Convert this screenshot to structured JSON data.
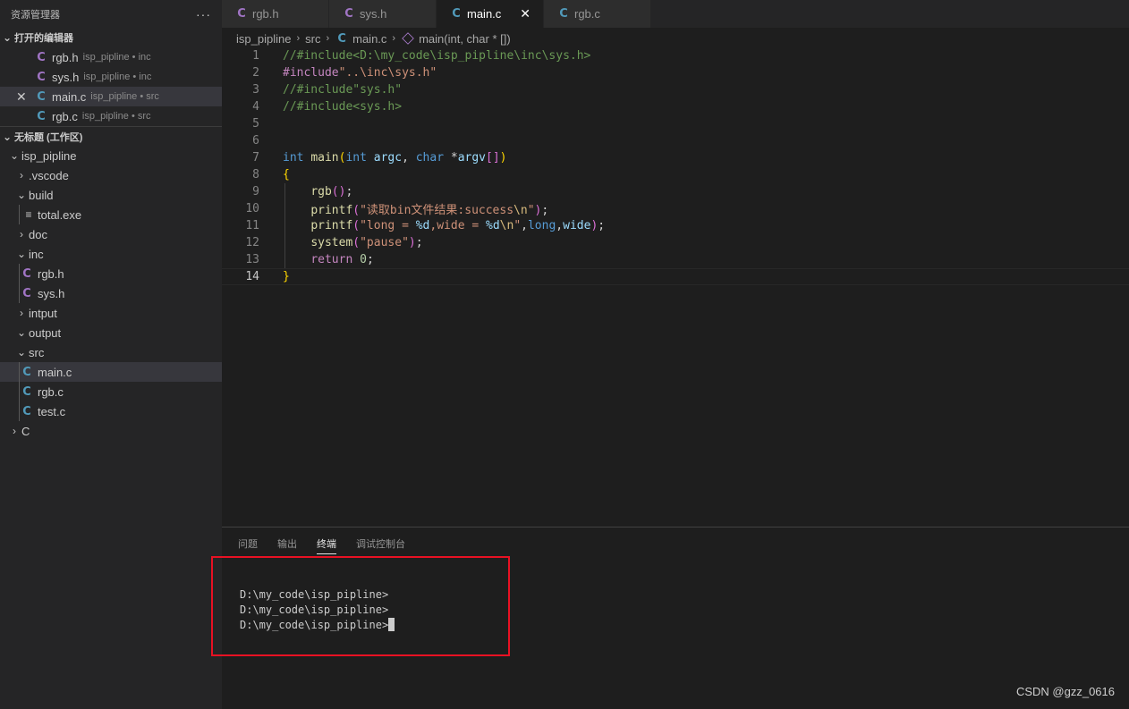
{
  "sidebar": {
    "title": "资源管理器",
    "more": "···",
    "open_editors_label": "打开的编辑器",
    "open_editors": [
      {
        "icon": "C",
        "name": "rgb.h",
        "desc": "isp_pipline • inc"
      },
      {
        "icon": "C",
        "name": "sys.h",
        "desc": "isp_pipline • inc"
      },
      {
        "icon": "C",
        "name": "main.c",
        "desc": "isp_pipline • src"
      },
      {
        "icon": "C",
        "name": "rgb.c",
        "desc": "isp_pipline • src"
      }
    ],
    "workspace_label": "无标题 (工作区)",
    "tree": {
      "root": "isp_pipline",
      "vscode": ".vscode",
      "build": "build",
      "total_exe": "total.exe",
      "doc": "doc",
      "inc": "inc",
      "inc_rgb_h": "rgb.h",
      "inc_sys_h": "sys.h",
      "intput": "intput",
      "output": "output",
      "src": "src",
      "src_main_c": "main.c",
      "src_rgb_c": "rgb.c",
      "src_test_c": "test.c",
      "c_folder": "C"
    }
  },
  "tabs": [
    {
      "icon": "C",
      "label": "rgb.h"
    },
    {
      "icon": "C",
      "label": "sys.h"
    },
    {
      "icon": "C",
      "label": "main.c"
    },
    {
      "icon": "C",
      "label": "rgb.c"
    }
  ],
  "tab_close": "✕",
  "breadcrumb": {
    "folder": "isp_pipline",
    "sub": "src",
    "file_icon": "C",
    "file": "main.c",
    "symbol": "main(int, char * [])"
  },
  "editor": {
    "line_numbers": [
      "1",
      "2",
      "3",
      "4",
      "5",
      "6",
      "7",
      "8",
      "9",
      "10",
      "11",
      "12",
      "13",
      "14"
    ],
    "l1": "//#include<D:\\my_code\\isp_pipline\\inc\\sys.h>",
    "l2_a": "#include",
    "l2_b": "\"..\\inc\\sys.h\"",
    "l3": "//#include\"sys.h\"",
    "l4": "//#include<sys.h>",
    "l7_int": "int",
    "l7_main": "main",
    "l7_open": "(",
    "l7_int2": "int",
    "l7_argc": "argc",
    "l7_comma": ", ",
    "l7_char": "char",
    "l7_star": " *",
    "l7_argv": "argv",
    "l7_brk": "[]",
    "l7_close": ")",
    "l8": "{",
    "l9_fn": "rgb",
    "l9_paren": "()",
    "l9_semi": ";",
    "l10_fn": "printf",
    "l10_open": "(",
    "l10_str": "\"读取bin文件结果:success",
    "l10_esc": "\\n",
    "l10_q": "\"",
    "l10_close": ")",
    "l10_semi": ";",
    "l11_fn": "printf",
    "l11_open": "(",
    "l11_s1": "\"long = ",
    "l11_f1": "%d",
    "l11_s2": ",wide = ",
    "l11_f2": "%d",
    "l11_esc": "\\n",
    "l11_q": "\"",
    "l11_c1": ",",
    "l11_long": "long",
    "l11_c2": ",",
    "l11_wide": "wide",
    "l11_close": ")",
    "l11_semi": ";",
    "l12_fn": "system",
    "l12_open": "(",
    "l12_str": "\"pause\"",
    "l12_close": ")",
    "l12_semi": ";",
    "l13_kw": "return",
    "l13_num": "0",
    "l13_semi": ";",
    "l14": "}"
  },
  "panel": {
    "tabs": [
      "问题",
      "输出",
      "终端",
      "调试控制台"
    ],
    "active_tab": "终端",
    "terminal_lines": [
      "D:\\my_code\\isp_pipline>",
      "D:\\my_code\\isp_pipline>",
      "D:\\my_code\\isp_pipline>"
    ]
  },
  "watermark": "CSDN @gzz_0616"
}
